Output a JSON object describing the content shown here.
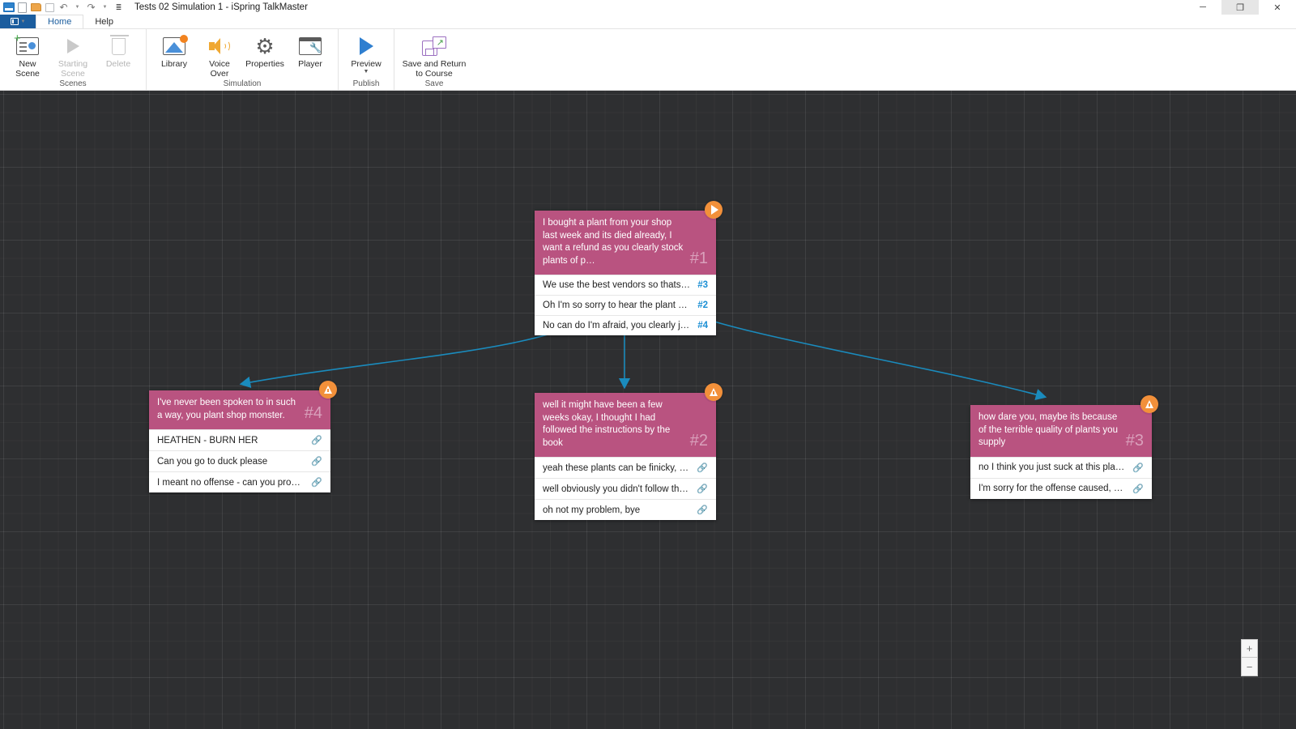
{
  "window": {
    "title": "Tests 02 Simulation 1 - iSpring TalkMaster",
    "quick_access": [
      {
        "name": "app-logo",
        "label": ""
      },
      {
        "name": "new-icon",
        "label": ""
      },
      {
        "name": "open-folder-icon",
        "label": ""
      },
      {
        "name": "save-icon",
        "label": ""
      },
      {
        "name": "undo-icon",
        "label": "↶"
      },
      {
        "name": "redo-icon",
        "label": "↷"
      },
      {
        "name": "customize-icon",
        "label": "☰"
      }
    ],
    "controls": {
      "minimize": "─",
      "maximize": "❐",
      "close": "✕"
    }
  },
  "ribbon": {
    "file_button": "",
    "tabs": [
      {
        "label": "Home",
        "active": true
      },
      {
        "label": "Help",
        "active": false
      }
    ],
    "groups": [
      {
        "title": "Scenes",
        "buttons": [
          {
            "label": "New\nScene",
            "icon": "new-scene-icon",
            "disabled": false
          },
          {
            "label": "Starting\nScene",
            "icon": "starting-scene-icon",
            "disabled": true
          },
          {
            "label": "Delete",
            "icon": "delete-icon",
            "disabled": true
          }
        ]
      },
      {
        "title": "Simulation",
        "buttons": [
          {
            "label": "Library",
            "icon": "library-icon",
            "disabled": false
          },
          {
            "label": "Voice\nOver",
            "icon": "voice-over-icon",
            "disabled": false
          },
          {
            "label": "Properties",
            "icon": "properties-icon",
            "disabled": false
          },
          {
            "label": "Player",
            "icon": "player-icon",
            "disabled": false
          }
        ]
      },
      {
        "title": "Publish",
        "buttons": [
          {
            "label": "Preview",
            "icon": "preview-icon",
            "disabled": false,
            "has_dropdown": true
          }
        ]
      },
      {
        "title": "Save",
        "buttons": [
          {
            "label": "Save and Return\nto Course",
            "icon": "save-return-icon",
            "disabled": false
          }
        ]
      }
    ]
  },
  "canvas": {
    "zoom_controls": {
      "zoom_in": "+",
      "zoom_out": "−"
    },
    "accent_colors": {
      "node_header": "#b95380",
      "badge": "#f2903a",
      "edge": "#1a8bbd",
      "reply_number": "#1b8fd4",
      "canvas_background": "#2e2f31"
    },
    "nodes": [
      {
        "id": "1",
        "number": "#1",
        "badge": "play",
        "prompt": "I bought a plant from your shop last week and its died already, I want a refund as you clearly stock plants of p…",
        "replies": [
          {
            "text": "We use the best vendors so thats not tr…",
            "target": "#3",
            "link": false
          },
          {
            "text": "Oh I'm so sorry to hear the plant died, …",
            "target": "#2",
            "link": false
          },
          {
            "text": "No can do I'm afraid, you clearly just w…",
            "target": "#4",
            "link": false
          }
        ]
      },
      {
        "id": "4",
        "number": "#4",
        "badge": "warning",
        "prompt": "I've never been spoken to in such a way, you plant shop monster.",
        "replies": [
          {
            "text": "HEATHEN - BURN HER",
            "target": "",
            "link": true
          },
          {
            "text": "Can you go to duck please",
            "target": "",
            "link": true
          },
          {
            "text": "I meant no offense - can you provide m…",
            "target": "",
            "link": true
          }
        ]
      },
      {
        "id": "2",
        "number": "#2",
        "badge": "warning",
        "prompt": "well it might have been a few weeks okay, I thought I had followed the instructions by the book",
        "replies": [
          {
            "text": "yeah these plants can be finicky, I know…",
            "target": "",
            "link": true
          },
          {
            "text": "well obviously you didn't follow them …",
            "target": "",
            "link": true
          },
          {
            "text": "oh not my problem, bye",
            "target": "",
            "link": true
          }
        ]
      },
      {
        "id": "3",
        "number": "#3",
        "badge": "warning",
        "prompt": "how dare you, maybe its because of the terrible quality of plants you supply",
        "replies": [
          {
            "text": "no I think you just suck at this plant ow…",
            "target": "",
            "link": true
          },
          {
            "text": "I'm sorry for the offense caused, we try …",
            "target": "",
            "link": true
          }
        ]
      }
    ]
  }
}
